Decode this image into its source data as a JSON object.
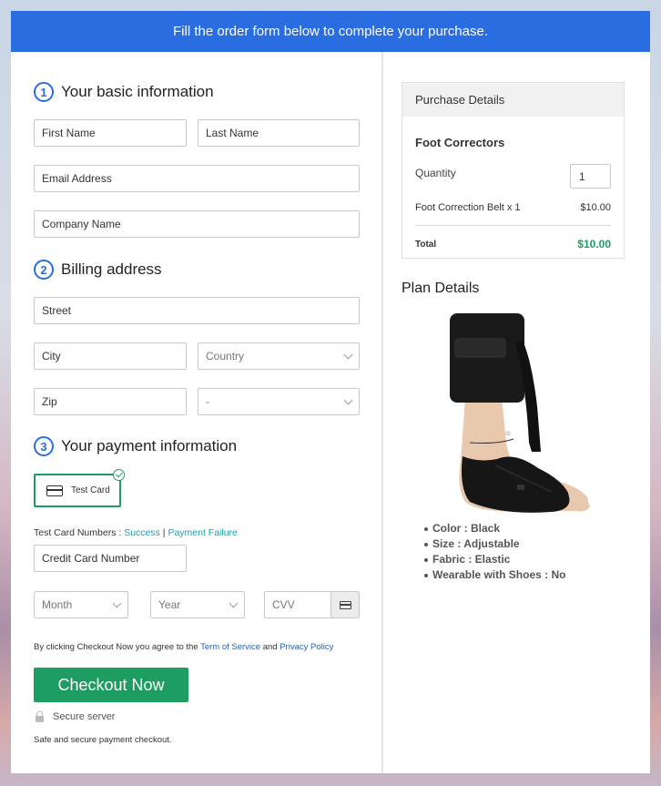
{
  "banner": {
    "text": "Fill the order form below to complete your purchase."
  },
  "sections": {
    "basic": {
      "number": "1",
      "title": "Your basic information"
    },
    "billing": {
      "number": "2",
      "title": "Billing address"
    },
    "payment": {
      "number": "3",
      "title": "Your payment information"
    }
  },
  "fields": {
    "first_name": "First Name",
    "last_name": "Last Name",
    "email": "Email Address",
    "company": "Company Name",
    "street": "Street",
    "city": "City",
    "country": "Country",
    "zip": "Zip",
    "state": "-",
    "credit_card": "Credit Card Number",
    "month": "Month",
    "year": "Year",
    "cvv": "CVV"
  },
  "payment": {
    "method_label": "Test Card",
    "test_numbers_prefix": "Test Card Numbers : ",
    "success_link": "Success",
    "separator": " | ",
    "failure_link": "Payment Failure"
  },
  "agreement": {
    "prefix": "By clicking Checkout Now you agree to the ",
    "terms": "Term of Service",
    "and": " and ",
    "privacy": "Privacy Policy"
  },
  "checkout": {
    "button": "Checkout Now",
    "secure": "Secure server",
    "safe": "Safe and secure payment checkout."
  },
  "purchase": {
    "header": "Purchase Details",
    "product": "Foot Correctors",
    "quantity_label": "Quantity",
    "quantity": "1",
    "line_item": "Foot Correction Belt x 1",
    "line_price": "$10.00",
    "total_label": "Total",
    "total_value": "$10.00"
  },
  "plan": {
    "title": "Plan Details",
    "attributes": [
      "Color : Black",
      "Size : Adjustable",
      "Fabric : Elastic",
      "Wearable with Shoes : No"
    ]
  },
  "colors": {
    "banner": "#2a6de1",
    "accent": "#1e9d62",
    "link": "#1aa0a8"
  }
}
